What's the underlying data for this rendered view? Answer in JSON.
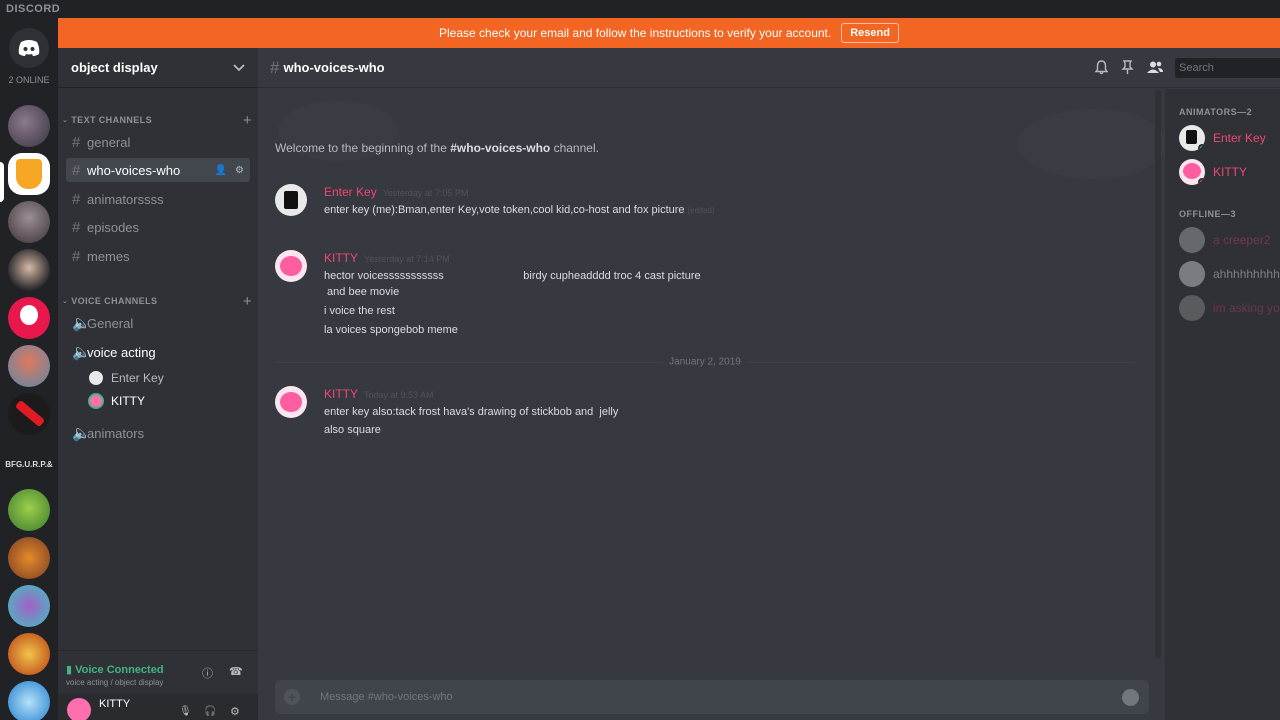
{
  "app": {
    "brand": "DISCORD",
    "online_count": "2 ONLINE"
  },
  "banner": {
    "text": "Please check your email and follow the instructions to verify your account.",
    "resend_label": "Resend"
  },
  "guild_bar": {
    "text_guild": "BFG.U.R.P.&"
  },
  "server": {
    "name": "object display"
  },
  "sidebar": {
    "text_category": "TEXT CHANNELS",
    "text_channels": [
      "general",
      "who-voices-who",
      "animatorssss",
      "episodes",
      "memes"
    ],
    "voice_category": "VOICE CHANNELS",
    "voice_channels": [
      "General",
      "voice acting",
      "animators"
    ],
    "voice_users": [
      "Enter Key",
      "KITTY"
    ]
  },
  "voice_status": {
    "label": "Voice Connected",
    "sub": "voice acting / object display"
  },
  "user": {
    "name": "KITTY"
  },
  "channel": {
    "name": "who-voices-who",
    "search_placeholder": "Search"
  },
  "welcome": {
    "prefix": "Welcome to the beginning of the ",
    "channel": "#who-voices-who",
    "suffix": " channel."
  },
  "messages": [
    {
      "author": "Enter Key",
      "timestamp": "Yesterday at 7:05 PM",
      "lines": [
        "enter key (me):Bman,enter Key,vote token,cool kid,co-host and fox picture"
      ],
      "edited": "(edited)"
    },
    {
      "author": "KITTY",
      "timestamp": "Yesterday at 7:14 PM",
      "lines": [
        "hector voicesssssssssss                          birdy cupheadddd troc 4 cast picture",
        " and bee movie",
        "i voice the rest",
        "la voices spongebob meme"
      ]
    },
    {
      "author": "KITTY",
      "timestamp": "Today at 9:53 AM",
      "lines": [
        "enter key also:tack frost hava's drawing of stickbob and  jelly",
        "also square"
      ]
    }
  ],
  "date_divider": "January 2, 2019",
  "composer": {
    "placeholder": "Message #who-voices-who"
  },
  "members": {
    "online_header": "ANIMATORS—2",
    "online": [
      "Enter Key",
      "KITTY"
    ],
    "offline_header": "OFFLINE—3",
    "offline": [
      "a creeper2",
      "ahhhhhhhhh",
      "im asking yo"
    ]
  },
  "colors": {
    "accent_pink": "#f04777",
    "banner": "#f26522",
    "online_green": "#43b581",
    "dnd_red": "#f04747"
  }
}
